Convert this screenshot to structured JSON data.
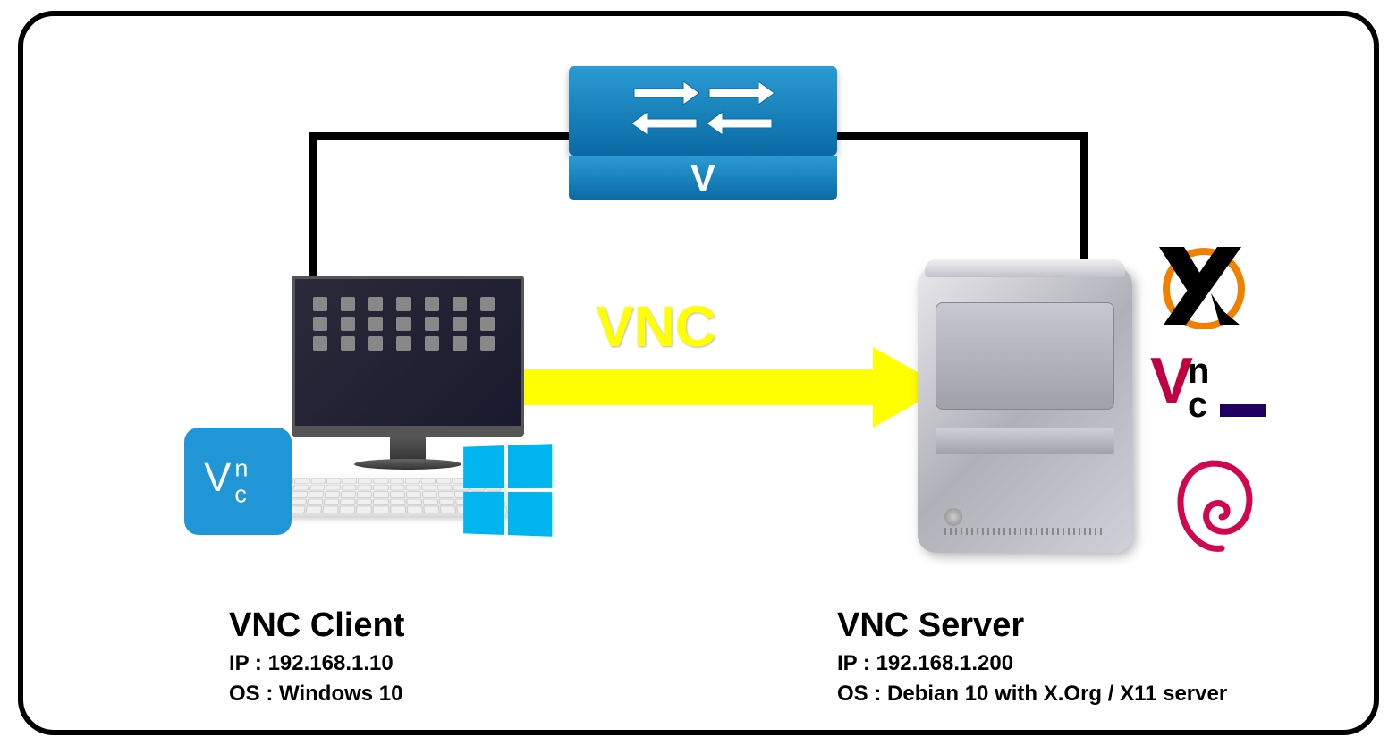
{
  "switch": {
    "label": "V"
  },
  "arrow": {
    "label": "VNC"
  },
  "client": {
    "title": "VNC Client",
    "ip_label": "IP : ",
    "ip": "192.168.1.10",
    "os_label": "OS : ",
    "os": "Windows 10",
    "vnc_logo_text": "Vnc"
  },
  "server": {
    "title": "VNC Server",
    "ip_label": "IP : ",
    "ip": "192.168.1.200",
    "os_label": "OS : ",
    "os": "Debian 10 with X.Org / X11 server",
    "vnc_logo_text": "Vnc"
  }
}
